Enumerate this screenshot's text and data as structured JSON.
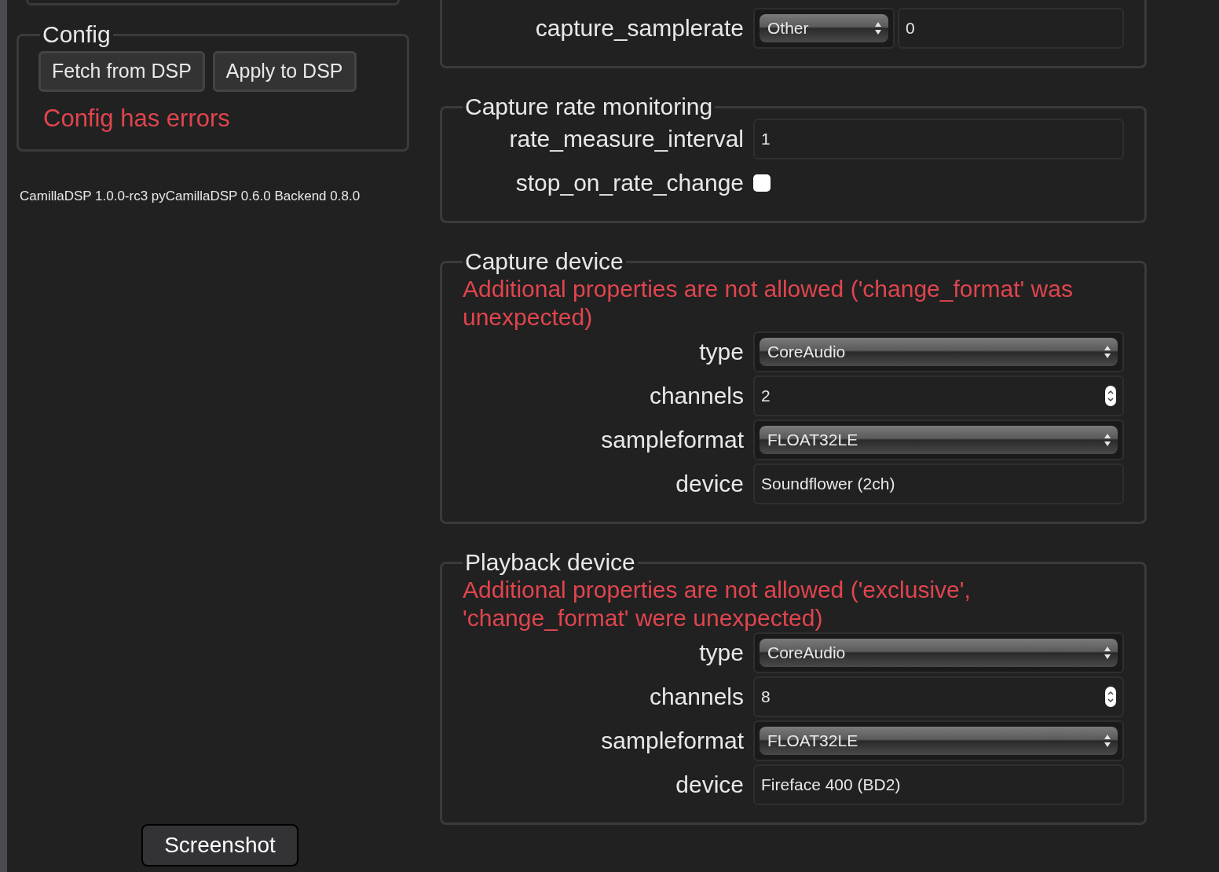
{
  "config": {
    "title": "Config",
    "buttons": [
      "Fetch from DSP",
      "Apply to DSP"
    ],
    "error": "Config has errors"
  },
  "version": "CamillaDSP 1.0.0-rc3 pyCamillaDSP 0.6.0 Backend 0.8.0",
  "tooltip": "Screenshot",
  "sections": [
    {
      "fields": [
        {
          "kind": "select_value",
          "label": "capture_samplerate",
          "value": "Other",
          "extra": "0"
        }
      ]
    },
    {
      "title": "Capture rate monitoring",
      "fields": [
        {
          "kind": "text",
          "label": "rate_measure_interval",
          "value": "1"
        },
        {
          "kind": "checkbox",
          "label": "stop_on_rate_change",
          "checked": false
        }
      ]
    },
    {
      "title": "Capture device",
      "error": "Additional properties are not allowed ('change_format' was unexpected)",
      "fields": [
        {
          "kind": "select",
          "label": "type",
          "value": "CoreAudio"
        },
        {
          "kind": "number",
          "label": "channels",
          "value": "2"
        },
        {
          "kind": "select",
          "label": "sampleformat",
          "value": "FLOAT32LE"
        },
        {
          "kind": "text",
          "label": "device",
          "value": "Soundflower (2ch)"
        }
      ]
    },
    {
      "title": "Playback device",
      "error": "Additional properties are not allowed ('exclusive', 'change_format' were unexpected)",
      "fields": [
        {
          "kind": "select",
          "label": "type",
          "value": "CoreAudio"
        },
        {
          "kind": "number",
          "label": "channels",
          "value": "8"
        },
        {
          "kind": "select",
          "label": "sampleformat",
          "value": "FLOAT32LE"
        },
        {
          "kind": "text",
          "label": "device",
          "value": "Fireface 400 (BD2)"
        }
      ]
    }
  ]
}
